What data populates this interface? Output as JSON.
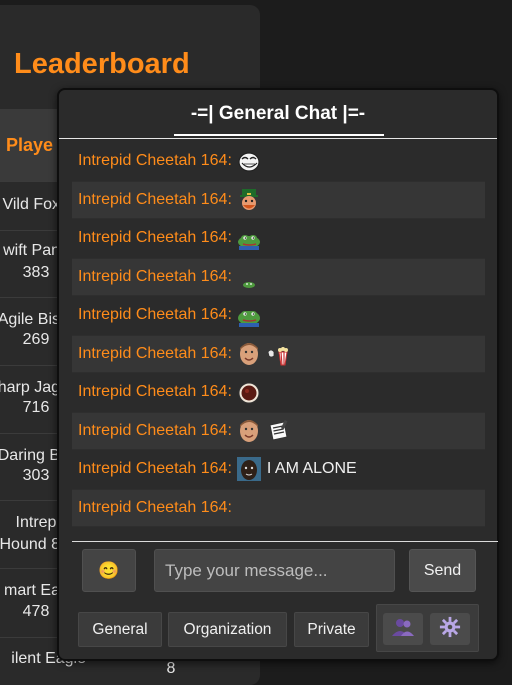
{
  "leaderboard": {
    "title": "Leaderboard",
    "header_label": "Playe",
    "rows": [
      {
        "name": "Vild Fox",
        "score": ""
      },
      {
        "name": "wift Pan",
        "score": "383"
      },
      {
        "name": "Agile Bis",
        "score": "269"
      },
      {
        "name": "harp Jag",
        "score": "716"
      },
      {
        "name": "Daring B",
        "score": "303"
      },
      {
        "name": "Intrepi",
        "name2": "Hound 8",
        "score": ""
      },
      {
        "name": "mart Ea",
        "score": "478"
      },
      {
        "name": "ilent Eagle",
        "score": "8"
      }
    ]
  },
  "chat": {
    "title": "-=| General Chat |=-",
    "messages": [
      {
        "author": "Intrepid Cheetah 164:",
        "emotes": [
          "trollface-emote"
        ],
        "text": ""
      },
      {
        "author": "Intrepid Cheetah 164:",
        "emotes": [
          "leprechaun-emote"
        ],
        "text": ""
      },
      {
        "author": "Intrepid Cheetah 164:",
        "emotes": [
          "pepe-frog-emote"
        ],
        "text": ""
      },
      {
        "author": "Intrepid Cheetah 164:",
        "emotes": [
          "tiny-frog-emote"
        ],
        "text": ""
      },
      {
        "author": "Intrepid Cheetah 164:",
        "emotes": [
          "pepe-frog-emote"
        ],
        "text": ""
      },
      {
        "author": "Intrepid Cheetah 164:",
        "emotes": [
          "face-emote",
          "popcorn-emote"
        ],
        "text": ""
      },
      {
        "author": "Intrepid Cheetah 164:",
        "emotes": [
          "red-circle-emote"
        ],
        "text": ""
      },
      {
        "author": "Intrepid Cheetah 164:",
        "emotes": [
          "face-emote",
          "notepad-emote"
        ],
        "text": ""
      },
      {
        "author": "Intrepid Cheetah 164:",
        "emotes": [
          "dark-face-emote"
        ],
        "text": "I AM ALONE"
      },
      {
        "author": "Intrepid Cheetah 164:",
        "emotes": [],
        "text": ""
      }
    ],
    "composer": {
      "emoji_icon": "😊",
      "placeholder": "Type your message...",
      "send_label": "Send"
    },
    "tabs": [
      "General",
      "Organization",
      "Private"
    ],
    "tray": {
      "friends_icon": "👥",
      "settings_icon": "⚙️"
    }
  },
  "colors": {
    "accent": "#ff8c1a",
    "panel_bg": "#2b2b2b",
    "row_alt_bg": "#363636"
  }
}
